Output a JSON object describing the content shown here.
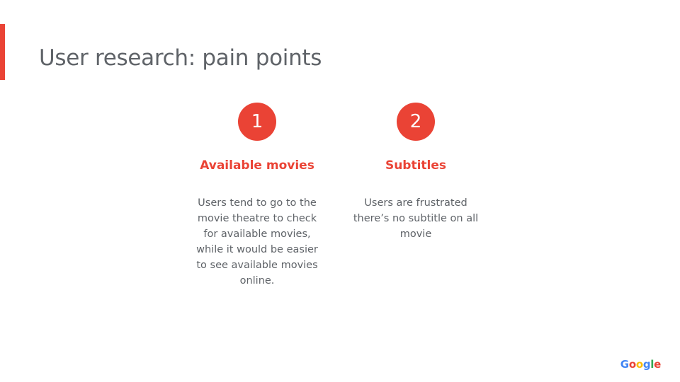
{
  "slide": {
    "title": "User research: pain points"
  },
  "pain_points": [
    {
      "number": "1",
      "title": "Available movies",
      "description": "Users tend to go to the movie theatre to check for available movies, while it would be easier to see available movies online."
    },
    {
      "number": "2",
      "title": "Subtitles",
      "description": "Users are frustrated there’s no subtitle on all movie"
    }
  ],
  "logo": {
    "text": "Google",
    "letters": [
      "G",
      "o",
      "o",
      "g",
      "l",
      "e"
    ]
  },
  "colors": {
    "accent": "#ea4335",
    "text": "#5f6368",
    "google_blue": "#4285f4",
    "google_red": "#ea4335",
    "google_yellow": "#fbbc05",
    "google_green": "#34a853"
  }
}
